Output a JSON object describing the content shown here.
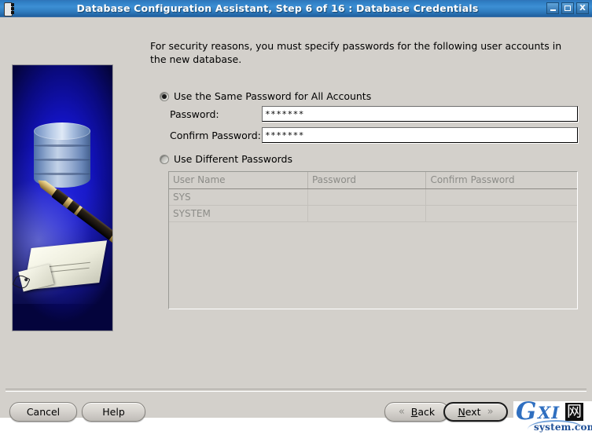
{
  "window": {
    "title": "Database Configuration Assistant, Step 6 of 16 : Database Credentials",
    "icon": "database-disk-icon",
    "controls": {
      "minimize": "_",
      "maximize": "□",
      "close": "X"
    }
  },
  "banner": {
    "alt": "database-cylinder-pen-document-illustration"
  },
  "main": {
    "intro": "For security reasons, you must specify passwords for the following user accounts in the new database.",
    "options": [
      {
        "id": "same",
        "label": "Use the Same Password for All Accounts",
        "selected": true
      },
      {
        "id": "different",
        "label": "Use Different Passwords",
        "selected": false
      }
    ],
    "fields": [
      {
        "id": "password",
        "label": "Password:",
        "value": "*******",
        "placeholder": ""
      },
      {
        "id": "confirm_password",
        "label": "Confirm Password:",
        "value": "*******",
        "placeholder": ""
      }
    ],
    "table": {
      "enabled": false,
      "columns": [
        "User Name",
        "Password",
        "Confirm Password"
      ],
      "rows": [
        {
          "user_name": "SYS",
          "password": "",
          "confirm_password": ""
        },
        {
          "user_name": "SYSTEM",
          "password": "",
          "confirm_password": ""
        }
      ]
    }
  },
  "footer": {
    "cancel_label": "Cancel",
    "help_label": "Help",
    "back_label": "Back",
    "back_icon": "«",
    "next_label": "Next",
    "next_icon": "»",
    "next_is_default": true
  },
  "watermark": {
    "g": "G",
    "xi": "XI",
    "cjk": "网",
    "domain": "system.com"
  },
  "colors": {
    "titlebar_blue": "#2f7ec4",
    "window_gray": "#d3d0cb",
    "banner_blue": "#0d0dbe",
    "disabled_text": "#8c8c88",
    "accent_link": "#2f6fc0"
  }
}
